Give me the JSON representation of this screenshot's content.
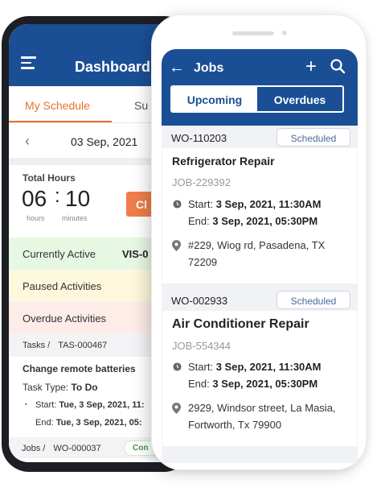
{
  "dashboard": {
    "title": "Dashboard",
    "tabs": [
      "My Schedule",
      "Su"
    ],
    "date": "03 Sep, 2021",
    "total_hours_label": "Total Hours",
    "hours": "06",
    "minutes": "10",
    "hours_unit": "hours",
    "minutes_unit": "minutes",
    "clock_button": "Cl",
    "activities": {
      "currently_active": "Currently Active",
      "currently_active_id": "VIS-0",
      "paused": "Paused Activities",
      "overdue": "Overdue Activities"
    },
    "task": {
      "section": "Tasks /",
      "id": "TAS-000467",
      "title": "Change remote batteries",
      "type_label": "Task Type:",
      "type_value": "To Do",
      "start_label": "Start:",
      "start_value": "Tue, 3 Sep, 2021, 11:",
      "end_label": "End:",
      "end_value": "Tue, 3 Sep, 2021, 05:"
    },
    "jobs_row": {
      "section": "Jobs /",
      "id": "WO-000037",
      "status": "Con"
    }
  },
  "jobs": {
    "title": "Jobs",
    "segments": [
      "Upcoming",
      "Overdues"
    ],
    "active_segment": "Upcoming",
    "items": [
      {
        "wo": "WO-110203",
        "status": "Scheduled",
        "title": "Refrigerator Repair",
        "job_id": "JOB-229392",
        "start_label": "Start:",
        "start": "3 Sep, 2021, 11:30AM",
        "end_label": "End:",
        "end": "3 Sep, 2021, 05:30PM",
        "address": "#229, Wiog rd, Pasadena, TX 72209"
      },
      {
        "wo": "WO-002933",
        "status": "Scheduled",
        "title": "Air Conditioner Repair",
        "job_id": "JOB-554344",
        "start_label": "Start:",
        "start": "3 Sep, 2021, 11:30AM",
        "end_label": "End:",
        "end": "3 Sep, 2021, 05:30PM",
        "address": "2929, Windsor street, La Masia, Fortworth, Tx 79900"
      }
    ]
  },
  "colors": {
    "brand_blue": "#1b4f95",
    "accent_orange": "#e8702a",
    "clock_button": "#ef7d4a",
    "active_bg": "#e6f7e2",
    "paused_bg": "#fdf7dc",
    "overdue_bg": "#fdece8"
  },
  "icons": [
    "menu-icon",
    "chevron-left-icon",
    "arrow-left-icon",
    "plus-icon",
    "search-icon",
    "clock-icon",
    "location-pin-icon"
  ]
}
